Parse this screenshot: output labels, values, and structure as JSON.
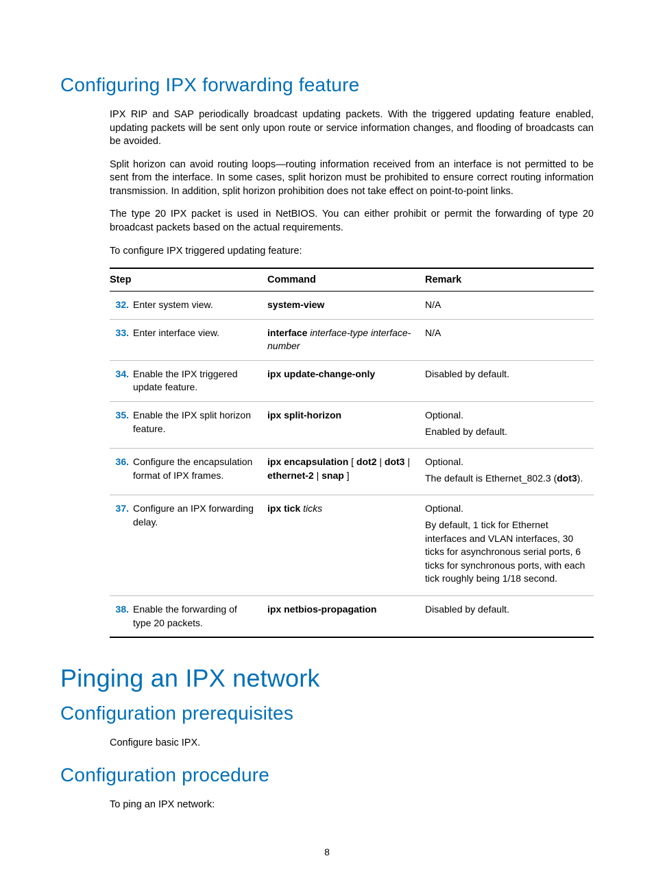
{
  "h_forwarding": "Configuring IPX forwarding feature",
  "p1": "IPX RIP and SAP periodically broadcast updating packets. With the triggered updating feature enabled, updating packets will be sent only upon route or service information changes, and flooding of broadcasts can be avoided.",
  "p2": "Split horizon can avoid routing loops—routing information received from an interface is not permitted to be sent from the interface. In some cases, split horizon must be prohibited to ensure correct routing information transmission. In addition, split horizon prohibition does not take effect on point-to-point links.",
  "p3": "The type 20 IPX packet is used in NetBIOS. You can either prohibit or permit the forwarding of type 20 broadcast packets based on the actual requirements.",
  "p4": "To configure IPX triggered updating feature:",
  "th_step": "Step",
  "th_cmd": "Command",
  "th_rem": "Remark",
  "rows": [
    {
      "num": "32.",
      "step": "Enter system view.",
      "cmd_bold_a": "system-view",
      "cmd_ital_a": "",
      "cmd_line2_bold": "",
      "cmd_line2_ital": "",
      "rem1": "N/A",
      "rem2": "",
      "rem3": ""
    },
    {
      "num": "33.",
      "step": "Enter interface view.",
      "cmd_bold_a": "interface",
      "cmd_ital_a": " interface-type interface-number",
      "cmd_line2_bold": "",
      "cmd_line2_ital": "",
      "rem1": "N/A",
      "rem2": "",
      "rem3": ""
    },
    {
      "num": "34.",
      "step": "Enable the IPX triggered update feature.",
      "cmd_bold_a": "ipx update-change-only",
      "cmd_ital_a": "",
      "cmd_line2_bold": "",
      "cmd_line2_ital": "",
      "rem1": "Disabled by default.",
      "rem2": "",
      "rem3": ""
    },
    {
      "num": "35.",
      "step": "Enable the IPX split horizon feature.",
      "cmd_bold_a": "ipx split-horizon",
      "cmd_ital_a": "",
      "cmd_line2_bold": "",
      "cmd_line2_ital": "",
      "rem1": "Optional.",
      "rem2": "Enabled by default.",
      "rem3": ""
    },
    {
      "num": "36.",
      "step": "Configure the encapsulation format of IPX frames.",
      "cmd_bold_a": "ipx encapsulation",
      "cmd_ital_a": "",
      "cmd_line2_bold": "",
      "cmd_line2_ital": "",
      "rem1": "Optional.",
      "rem2_pre": "The default is Ethernet_802.3 (",
      "rem2_bold": "dot3",
      "rem2_post": ").",
      "rem3": ""
    },
    {
      "num": "37.",
      "step": "Configure an IPX forwarding delay.",
      "cmd_bold_a": "ipx tick",
      "cmd_ital_a": " ticks",
      "cmd_line2_bold": "",
      "cmd_line2_ital": "",
      "rem1": "Optional.",
      "rem2": "By default, 1 tick for Ethernet interfaces and VLAN interfaces, 30 ticks for asynchronous serial ports, 6 ticks for synchronous ports, with each tick roughly being 1/18 second.",
      "rem3": ""
    },
    {
      "num": "38.",
      "step": "Enable the forwarding of type 20 packets.",
      "cmd_bold_a": "ipx netbios-propagation",
      "cmd_ital_a": "",
      "cmd_line2_bold": "",
      "cmd_line2_ital": "",
      "rem1": "Disabled by default.",
      "rem2": "",
      "rem3": ""
    }
  ],
  "encap_opts": " [ dot2 | dot3 | ethernet-2 | snap ]",
  "h_ping": "Pinging an IPX network",
  "h_prereq": "Configuration prerequisites",
  "p_prereq": "Configure basic IPX.",
  "h_proc": "Configuration procedure",
  "p_proc": "To ping an IPX network:",
  "pagenum": "8"
}
